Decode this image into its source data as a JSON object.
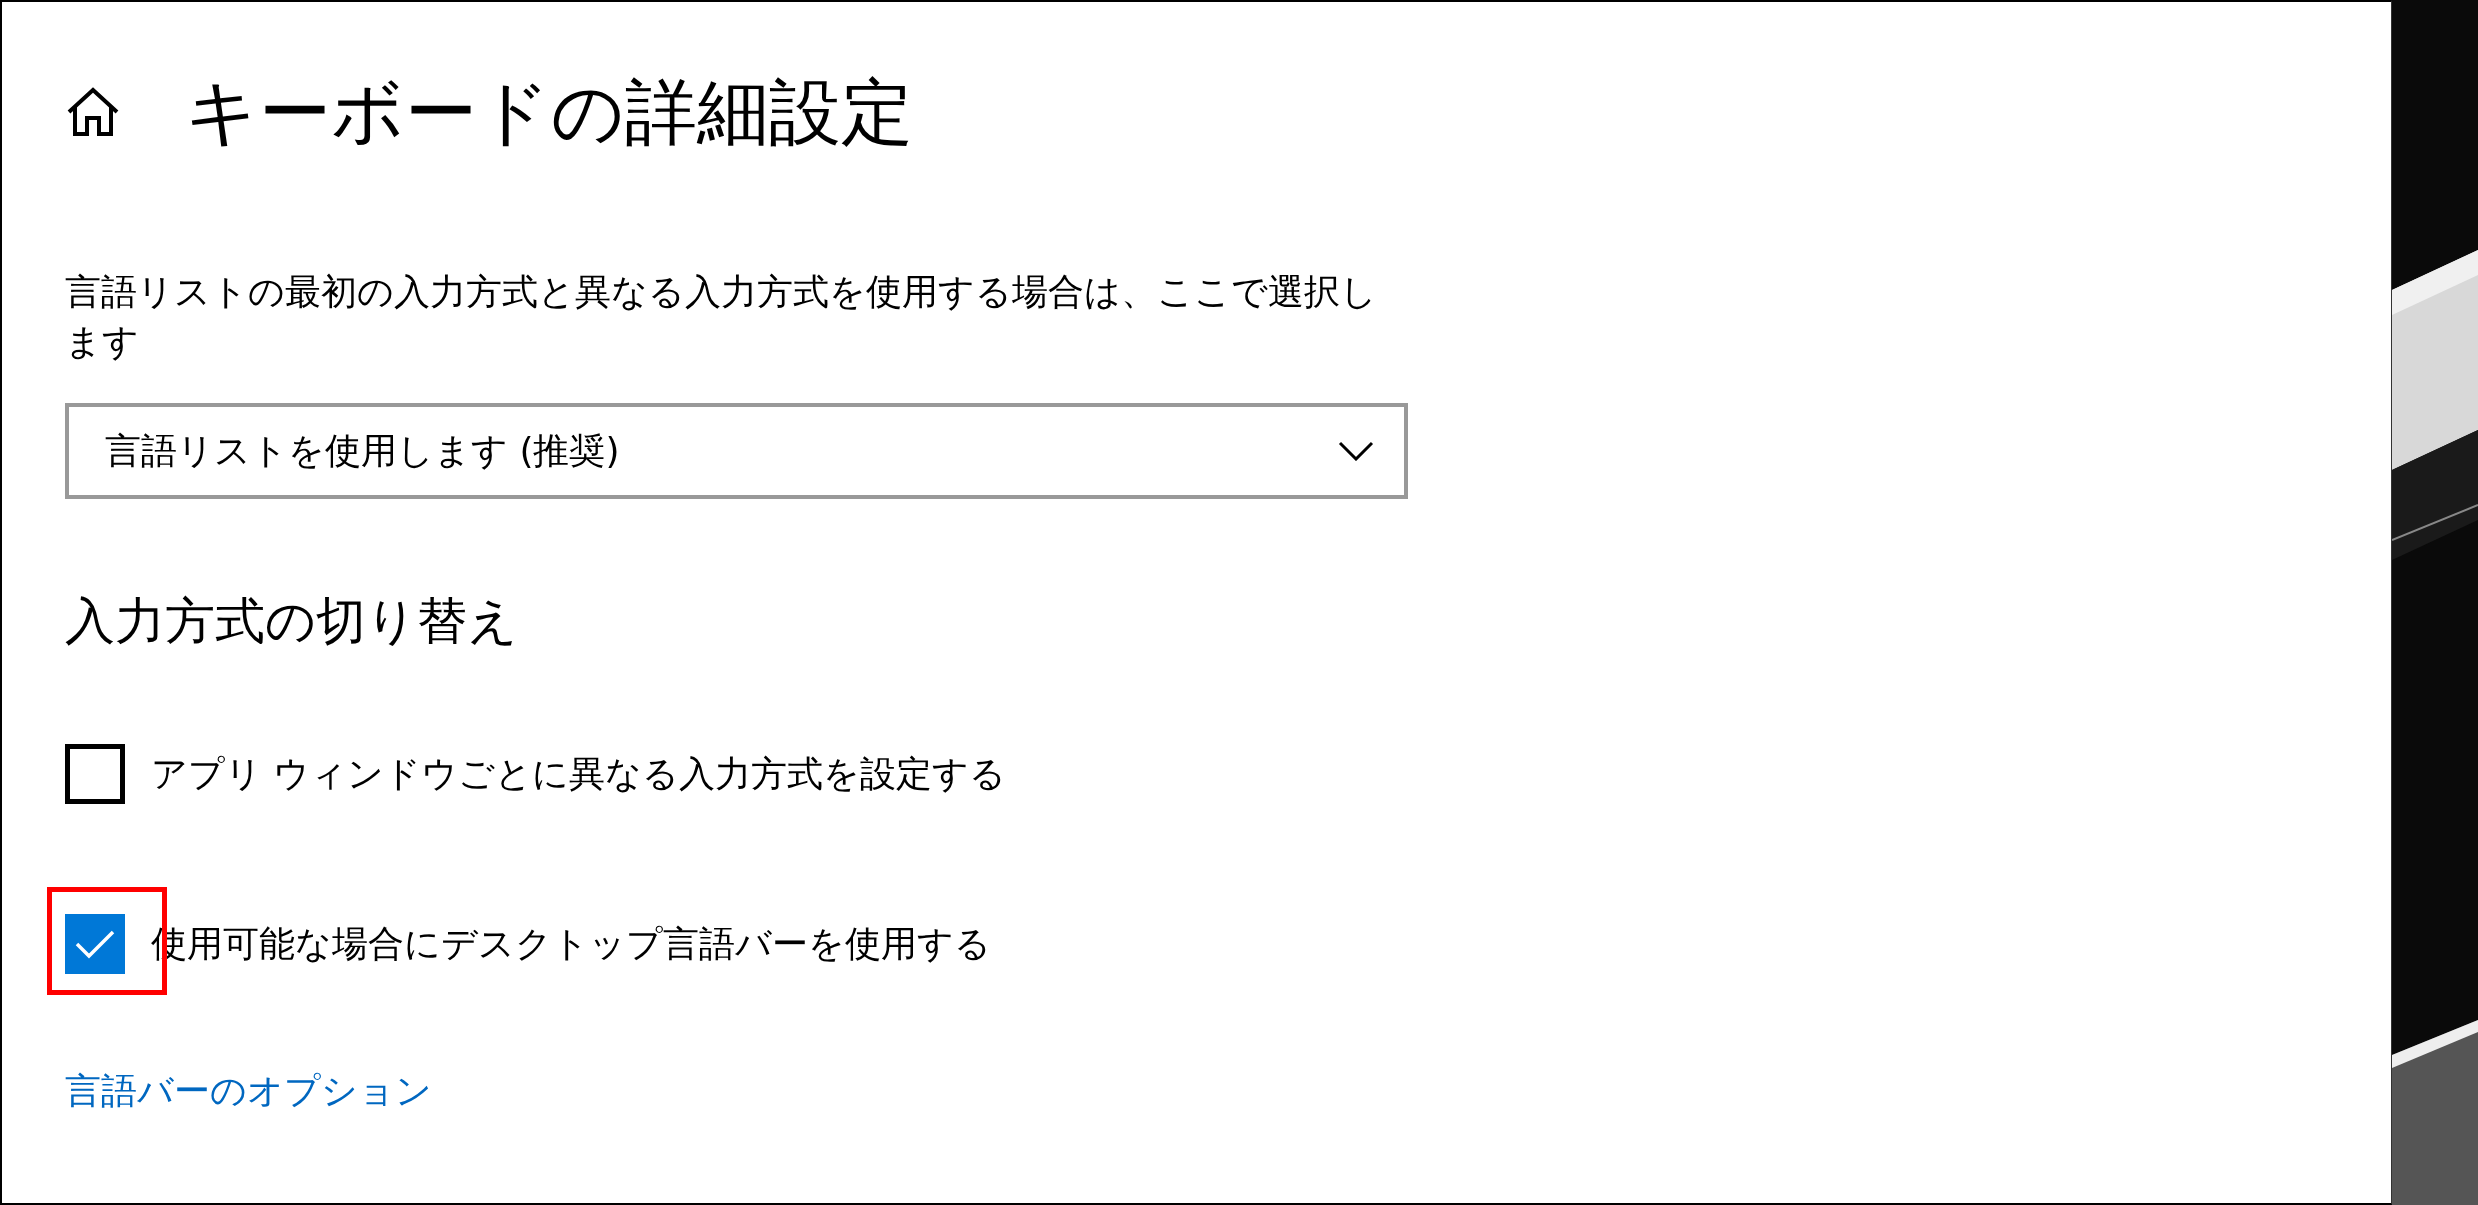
{
  "header": {
    "title": "キーボードの詳細設定"
  },
  "input_method_override": {
    "description": "言語リストの最初の入力方式と異なる入力方式を使用する場合は、ここで選択します",
    "dropdown": {
      "value": "言語リストを使用します (推奨)"
    }
  },
  "switching": {
    "heading": "入力方式の切り替え",
    "checkboxes": [
      {
        "label": "アプリ ウィンドウごとに異なる入力方式を設定する",
        "checked": false,
        "highlighted": false
      },
      {
        "label": "使用可能な場合にデスクトップ言語バーを使用する",
        "checked": true,
        "highlighted": true
      }
    ],
    "link": "言語バーのオプション"
  }
}
